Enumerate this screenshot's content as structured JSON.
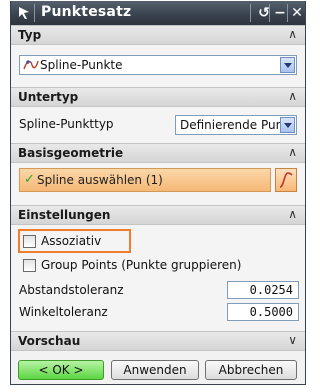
{
  "window": {
    "title": "Punktesatz",
    "app_icon": "nx-logo-icon",
    "buttons": {
      "reset": "↺",
      "minimize": "−",
      "close": "✕"
    }
  },
  "sections": {
    "typ": {
      "header": "Typ",
      "combo_value": "Spline-Punkte",
      "combo_icon": "spline-points-icon"
    },
    "untertyp": {
      "header": "Untertyp",
      "row_label": "Spline-Punkttyp",
      "combo_value": "Definierende Punkt"
    },
    "basisgeometrie": {
      "header": "Basisgeometrie",
      "select_label": "Spline auswählen (1)",
      "select_icon": "checkmark-icon",
      "spline_icon": "spline-curve-icon"
    },
    "einstellungen": {
      "header": "Einstellungen",
      "assoc_label": "Assoziativ",
      "group_label": "Group Points (Punkte gruppieren)",
      "abstand_label": "Abstandstoleranz",
      "abstand_value": "0.0254",
      "winkel_label": "Winkeltoleranz",
      "winkel_value": "0.5000"
    },
    "vorschau": {
      "header": "Vorschau"
    }
  },
  "footer": {
    "ok": "< OK >",
    "apply": "Anwenden",
    "cancel": "Abbrechen"
  },
  "colors": {
    "titlebar": "#38424d",
    "highlight": "#ef7d29",
    "ok_button": "#5bd642",
    "select_bar": "#f6b877"
  }
}
